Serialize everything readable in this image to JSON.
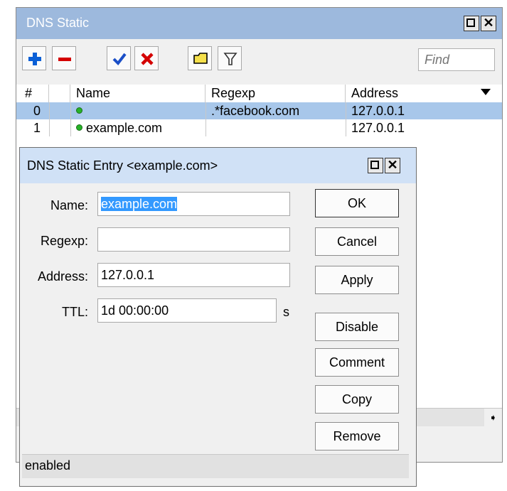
{
  "outer_window": {
    "title": "DNS Static",
    "find_placeholder": "Find",
    "columns": [
      "#",
      "Name",
      "Regexp",
      "Address"
    ],
    "rows": [
      {
        "num": "0",
        "name": "",
        "regexp": ".*facebook.com",
        "address": "127.0.0.1",
        "selected": true
      },
      {
        "num": "1",
        "name": "example.com",
        "regexp": "",
        "address": "127.0.0.1",
        "selected": false
      }
    ]
  },
  "dialog": {
    "title": "DNS Static Entry <example.com>",
    "fields": {
      "name": {
        "label": "Name:",
        "value": "example.com"
      },
      "regexp": {
        "label": "Regexp:",
        "value": ""
      },
      "address": {
        "label": "Address:",
        "value": "127.0.0.1"
      },
      "ttl": {
        "label": "TTL:",
        "value": "1d 00:00:00",
        "unit": "s"
      }
    },
    "buttons": {
      "ok": "OK",
      "cancel": "Cancel",
      "apply": "Apply",
      "disable": "Disable",
      "comment": "Comment",
      "copy": "Copy",
      "remove": "Remove"
    },
    "status": "enabled"
  },
  "icons": {
    "add": "plus-icon",
    "remove": "minus-icon",
    "enable": "check-icon",
    "disable": "x-icon",
    "comment": "comment-icon",
    "filter": "filter-icon",
    "enabled_dot": "status-dot-icon"
  },
  "colors": {
    "outer_titlebar": "#9db9dd",
    "inner_titlebar": "#d0e1f6",
    "selected_row": "#a8c7ea",
    "plus": "#0a5fd6",
    "minus": "#d40000",
    "check": "#1b4fc7",
    "x": "#d40000",
    "status_dot": "#27b327"
  }
}
